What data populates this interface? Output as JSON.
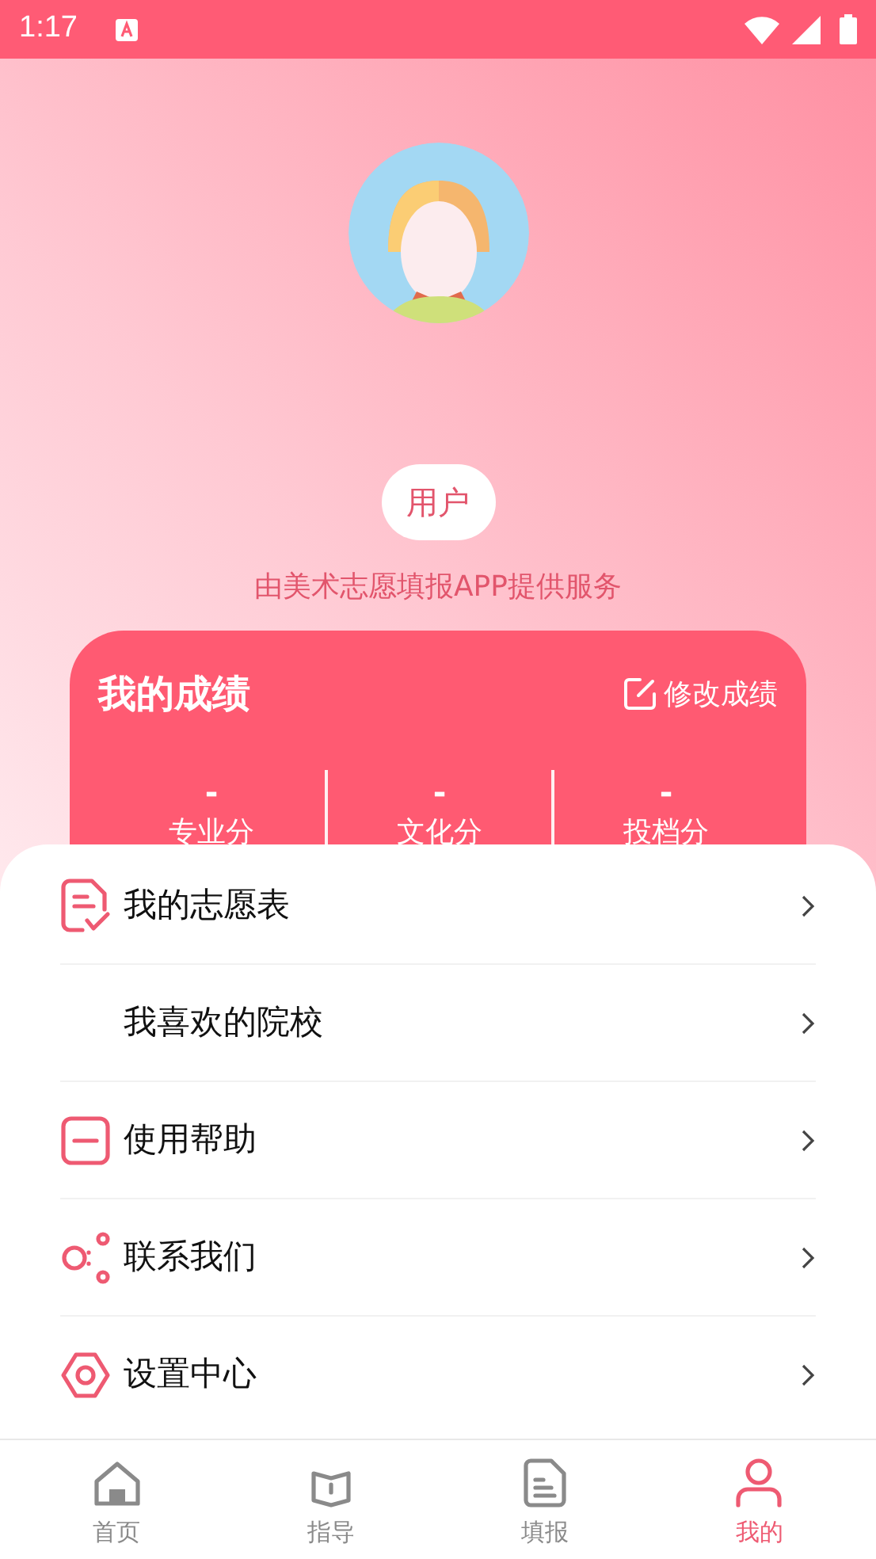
{
  "status_bar": {
    "time": "1:17"
  },
  "profile": {
    "username": "用户",
    "subtitle": "由美术志愿填报APP提供服务"
  },
  "scores_card": {
    "title": "我的成绩",
    "edit_link": "修改成绩",
    "scores": [
      {
        "value": "-",
        "label": "专业分"
      },
      {
        "value": "-",
        "label": "文化分"
      },
      {
        "value": "-",
        "label": "投档分"
      }
    ]
  },
  "menu": [
    {
      "label": "我的志愿表",
      "kind": "list"
    },
    {
      "label": "我喜欢的院校",
      "kind": "plain"
    },
    {
      "label": "使用帮助",
      "kind": "help"
    },
    {
      "label": "联系我们",
      "kind": "contact"
    },
    {
      "label": "设置中心",
      "kind": "settings"
    }
  ],
  "bottom_nav": [
    {
      "label": "首页",
      "kind": "home",
      "selected": false
    },
    {
      "label": "指导",
      "kind": "book",
      "selected": false
    },
    {
      "label": "填报",
      "kind": "doc",
      "selected": false
    },
    {
      "label": "我的",
      "kind": "user",
      "selected": true
    }
  ]
}
